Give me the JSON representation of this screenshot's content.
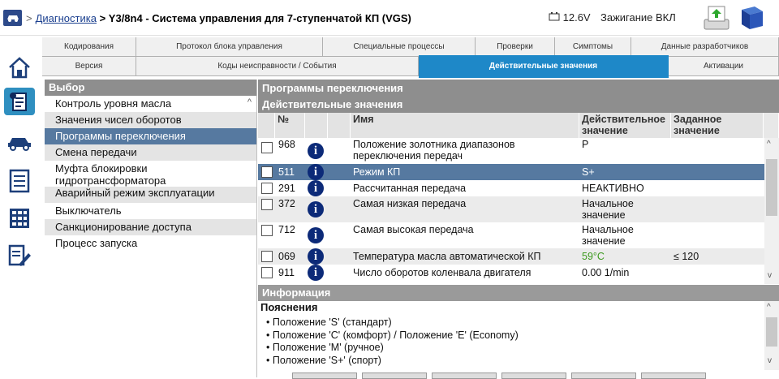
{
  "header": {
    "breadcrumb_sep": ">",
    "breadcrumb_link": "Диагностика",
    "breadcrumb_path": "> Y3/8n4 - Система управления для 7-ступенчатой КП (VGS)",
    "voltage": "12.6V",
    "ignition": "Зажигание ВКЛ"
  },
  "tabs_row1": [
    "Кодирования",
    "Протокол блока управления",
    "Специальные процессы",
    "Проверки",
    "Симптомы",
    "Данные разработчиков"
  ],
  "tabs_row2": [
    "Версия",
    "Коды неисправности / События",
    "Действительные значения",
    "Активации"
  ],
  "left": {
    "title": "Выбор",
    "items": [
      "Контроль уровня масла",
      "Значения чисел оборотов",
      "Программы переключения",
      "Смена передачи",
      "Муфта блокировки гидротрансформатора",
      "Аварийный режим эксплуатации",
      "Выключатель",
      "Санкционирование доступа",
      "Процесс запуска"
    ]
  },
  "right": {
    "title": "Программы переключения",
    "subtitle": "Действительные значения",
    "columns": {
      "num": "№",
      "name": "Имя",
      "actual": "Действительное значение",
      "target": "Заданное значение"
    },
    "rows": [
      {
        "num": "968",
        "name": "Положение золотника диапазонов переключения передач",
        "actual": "P",
        "target": ""
      },
      {
        "num": "511",
        "name": "Режим КП",
        "actual": "S+",
        "target": ""
      },
      {
        "num": "291",
        "name": "Рассчитанная передача",
        "actual": "НЕАКТИВНО",
        "target": ""
      },
      {
        "num": "372",
        "name": "Самая низкая передача",
        "actual": "Начальное значение",
        "target": ""
      },
      {
        "num": "712",
        "name": "Самая высокая передача",
        "actual": "Начальное значение",
        "target": ""
      },
      {
        "num": "069",
        "name": "Температура масла автоматической КП",
        "actual": "59°C",
        "target": "≤ 120"
      },
      {
        "num": "911",
        "name": "Число оборотов коленвала двигателя",
        "actual": "0.00 1/min",
        "target": ""
      }
    ],
    "info_title": "Информация",
    "info_heading": "Пояснения",
    "info_items": [
      "Положение 'S' (стандарт)",
      "Положение 'C' (комфорт) / Положение 'E' (Economy)",
      "Положение 'M' (ручное)",
      "Положение 'S+' (спорт)"
    ]
  },
  "colors": {
    "accent": "#1e88c8",
    "selected_row": "#5679a0",
    "header_gray": "#8e8e8e",
    "ok_green": "#3c9a1e"
  }
}
